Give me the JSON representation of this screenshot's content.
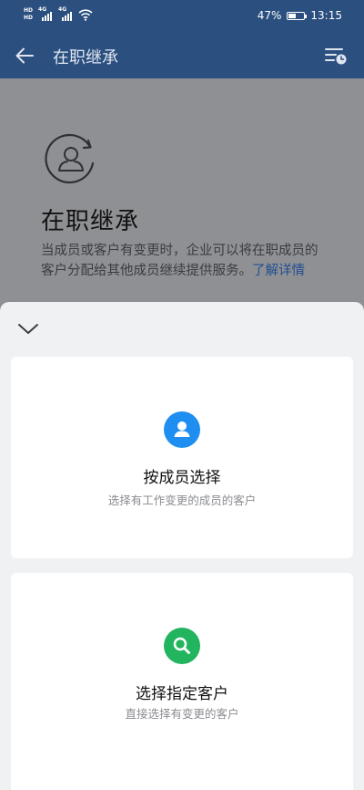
{
  "status_bar": {
    "hd_top": "HD",
    "hd_bottom": "HD",
    "network_1": "4G",
    "network_2": "4G",
    "battery_percent": "47%",
    "battery_level": 0.47,
    "time": "13:15"
  },
  "header": {
    "title": "在职继承",
    "back_icon": "arrow-left-icon",
    "history_icon": "list-clock-icon"
  },
  "intro": {
    "title": "在职继承",
    "description": "当成员或客户有变更时，企业可以将在职成员的客户分配给其他成员继续提供服务。",
    "learn_more": "了解详情"
  },
  "sheet": {
    "options": [
      {
        "title": "按成员选择",
        "subtitle": "选择有工作变更的成员的客户",
        "icon": "person-icon",
        "icon_color": "#1e8ff0"
      },
      {
        "title": "选择指定客户",
        "subtitle": "直接选择有变更的客户",
        "icon": "search-icon",
        "icon_color": "#22b45e"
      }
    ]
  },
  "colors": {
    "header_bg": "#2b4f7f",
    "overlay_bg": "#8f9093",
    "sheet_bg": "#f0f1f3",
    "link": "#224f91"
  }
}
